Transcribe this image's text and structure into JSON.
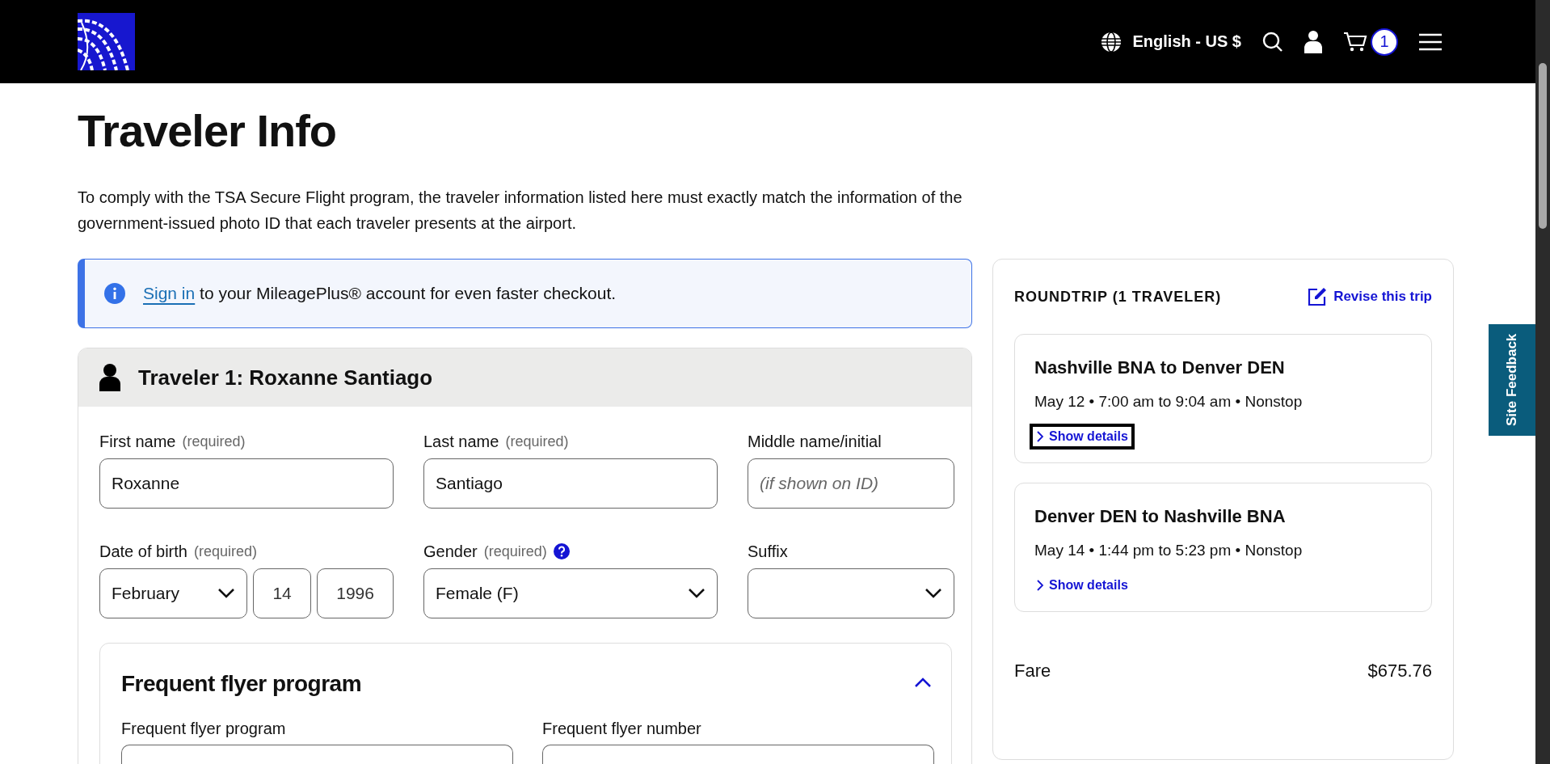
{
  "header": {
    "language": "English - US $",
    "cart_count": "1"
  },
  "title": "Traveler Info",
  "intro": "To comply with the TSA Secure Flight program, the traveler information listed here must exactly match the information of the government-issued photo ID that each traveler presents at the airport.",
  "notice": {
    "link": "Sign in",
    "text": "to your MileagePlus® account for even faster checkout."
  },
  "traveler": {
    "heading": "Traveler 1: Roxanne Santiago",
    "rows": [
      [
        {
          "kind": "text",
          "label": "First name",
          "note": "(required)",
          "value": "Roxanne"
        },
        {
          "kind": "text",
          "label": "Last name",
          "note": "(required)",
          "value": "Santiago"
        },
        {
          "kind": "text",
          "label": "Middle name/initial",
          "placeholder": "(if shown on ID)"
        }
      ],
      [
        {
          "kind": "date",
          "label": "Date of birth",
          "note": "(required)",
          "month": "February",
          "day": "14",
          "year": "1996"
        },
        {
          "kind": "select",
          "label": "Gender",
          "note": "(required)",
          "help": true,
          "value": "Female (F)"
        },
        {
          "kind": "select",
          "label": "Suffix"
        }
      ]
    ],
    "frequent_flyer": {
      "title": "Frequent flyer program",
      "expanded": true,
      "fields": [
        {
          "label": "Frequent flyer program"
        },
        {
          "label": "Frequent flyer number"
        }
      ]
    }
  },
  "summary": {
    "heading": "ROUNDTRIP (1 TRAVELER)",
    "revise": "Revise this trip",
    "segments": [
      {
        "route": "Nashville BNA to Denver DEN",
        "details": "May 12 • 7:00 am to 9:04 am • Nonstop",
        "link": "Show details",
        "focused": true
      },
      {
        "route": "Denver DEN to Nashville BNA",
        "details": "May 14 • 1:44 pm to 5:23 pm • Nonstop",
        "link": "Show details",
        "focused": false
      }
    ],
    "fare": {
      "label": "Fare",
      "amount": "$675.76"
    }
  },
  "feedback": "Site Feedback"
}
